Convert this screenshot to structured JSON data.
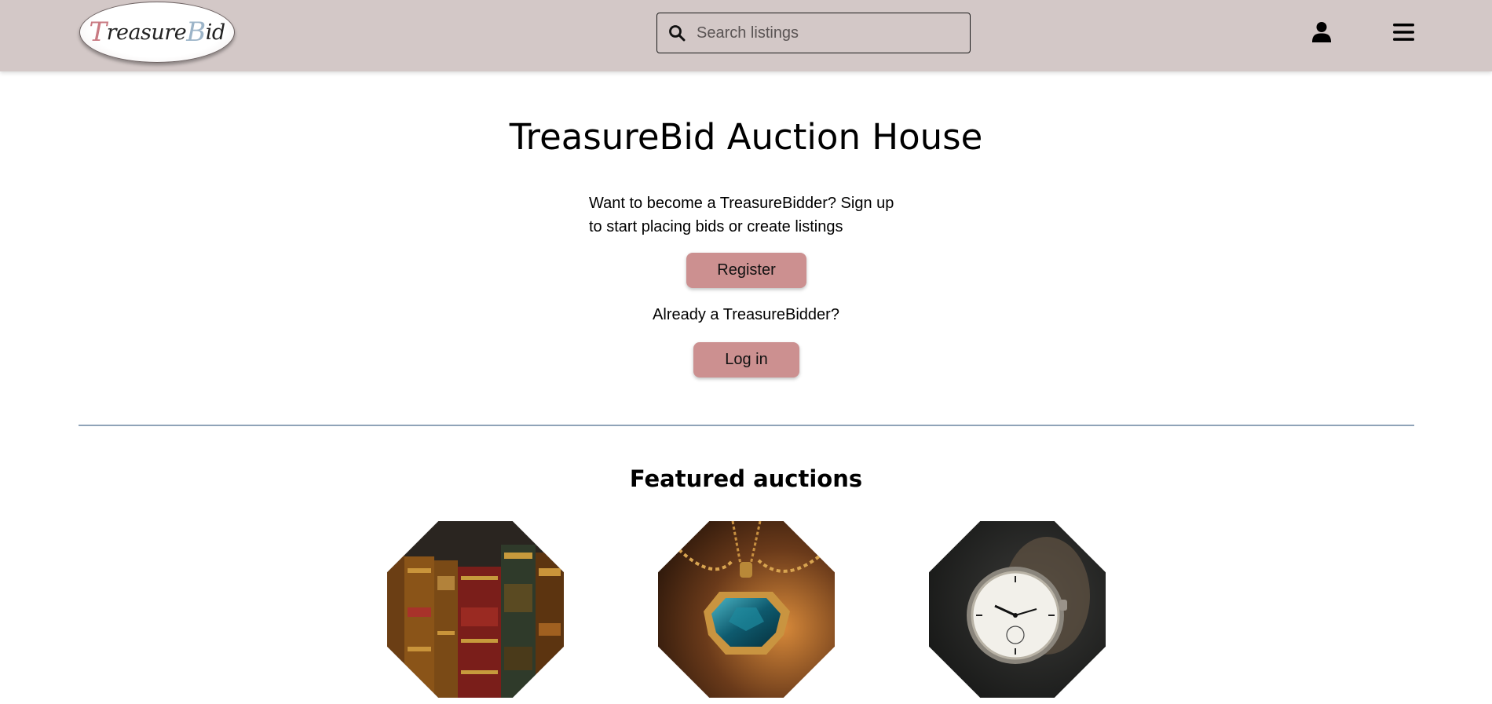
{
  "header": {
    "logo_text_t": "T",
    "logo_text_reasure": "reasure",
    "logo_text_b": "B",
    "logo_text_id": "id",
    "search": {
      "placeholder": "Search listings",
      "value": "",
      "icon": "search-icon"
    },
    "user_icon": "user-icon",
    "menu_icon": "hamburger-menu-icon"
  },
  "main": {
    "title": "TreasureBid Auction House",
    "intro_line1": "Want to become a TreasureBidder? Sign up",
    "intro_line2": "to start placing bids or create listings",
    "register_label": "Register",
    "already_text": "Already a TreasureBidder?",
    "login_label": "Log in"
  },
  "featured": {
    "title": "Featured auctions",
    "items": [
      {
        "image": "antique-books-image"
      },
      {
        "image": "gemstone-pendant-image"
      },
      {
        "image": "pocket-watch-image"
      }
    ]
  },
  "colors": {
    "header_bg": "#d3c8c7",
    "button_bg": "#cc9090",
    "divider": "#8fa3b8"
  }
}
